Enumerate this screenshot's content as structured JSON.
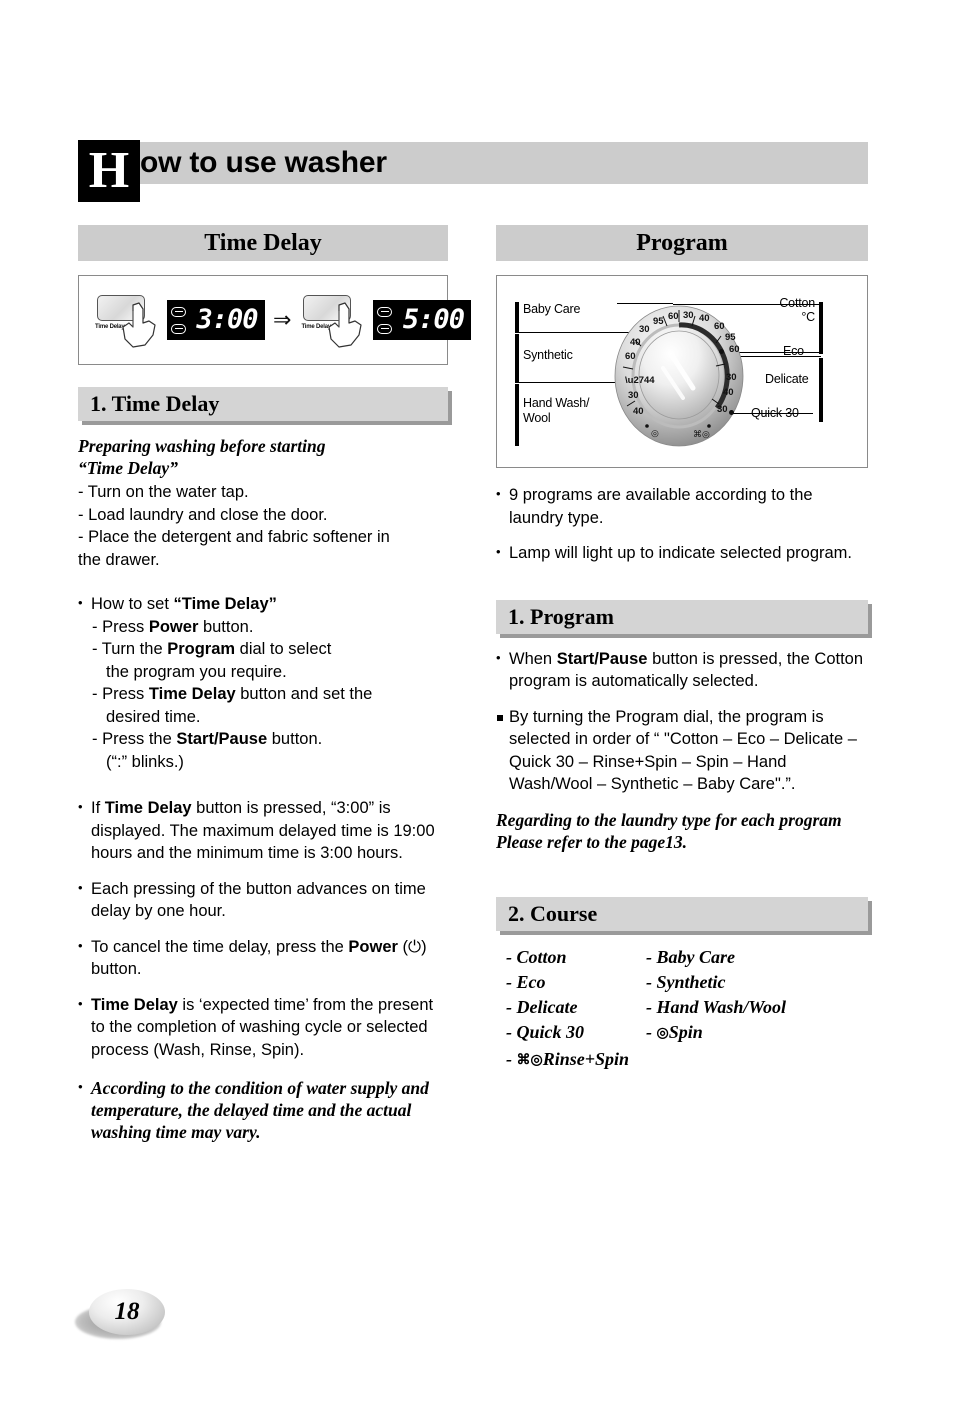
{
  "page": {
    "dropcap": "H",
    "header_title": "ow to use washer",
    "page_number": "18"
  },
  "left_column": {
    "title_bar": "Time Delay",
    "illustration": {
      "button_label_1": "Time Delay",
      "display_1": "3:00",
      "arrow": "⇒",
      "button_label_2": "Time Delay",
      "display_2": "5:00"
    },
    "sub_bar": "1. Time Delay",
    "intro_italic_line1": "Preparing washing before starting",
    "intro_italic_line2": "“Time Delay”",
    "prep_steps": [
      "- Turn on the water tap.",
      "- Load laundry and close the door.",
      "- Place the detergent and fabric softener in",
      "  the drawer."
    ],
    "howto_heading_plain": "How to set ",
    "howto_heading_bold": "“Time Delay”",
    "howto_steps": [
      {
        "pre": "- Press ",
        "bold": "Power",
        "post": " button."
      },
      {
        "pre": "- Turn the ",
        "bold": "Program",
        "post": " dial to select"
      },
      {
        "pre": "",
        "bold": "",
        "post": "the program you require."
      },
      {
        "pre": "- Press ",
        "bold": "Time Delay",
        "post": " button and set the"
      },
      {
        "pre": "",
        "bold": "",
        "post": "desired time."
      },
      {
        "pre": "- Press the ",
        "bold": "Start/Pause",
        "post": " button."
      },
      {
        "pre": "",
        "bold": "",
        "post": "(“:” blinks.)"
      }
    ],
    "para_if_pre": "If ",
    "para_if_bold": "Time Delay",
    "para_if_post": " button is pressed, “3:00” is displayed. The maximum delayed time is 19:00 hours and the minimum time is 3:00 hours.",
    "para_each": "Each pressing of the button advances on time delay by one hour.",
    "para_cancel_pre": "To cancel the time delay, press the ",
    "para_cancel_bold": "Power",
    "para_cancel_post": " (⏻) button.",
    "para_expected_bold": "Time Delay",
    "para_expected_post": " is ‘expected time’ from the present to the completion of washing cycle or selected process (Wash,  Rinse, Spin).",
    "para_note_italic": "According to the condition of water supply and temperature, the delayed time and the actual washing time may vary."
  },
  "right_column": {
    "title_bar": "Program",
    "dial": {
      "left_labels": [
        "Baby Care",
        "Synthetic",
        "Hand Wash/\nWool"
      ],
      "right_labels": [
        "Cotton\n°C",
        "Eco",
        "Delicate",
        "Quick 30"
      ],
      "ring_numbers_left": [
        "30",
        "95",
        "60",
        "40",
        "60",
        "30",
        "40"
      ],
      "ring_numbers_top": [
        "30",
        "40",
        "60"
      ],
      "ring_numbers_right": [
        "95",
        "60",
        "30",
        "40",
        "30"
      ]
    },
    "bullets_under_dial": [
      "9 programs are available according to the laundry type.",
      "Lamp will light up to indicate selected program."
    ],
    "sub_bar_program": "1. Program",
    "program_b1_pre": "When ",
    "program_b1_bold": "Start/Pause",
    "program_b1_post": " button is pressed, the Cotton program is automatically selected.",
    "program_b2": "By turning the Program dial, the program is selected in order of  “ \"Cotton – Eco – Delicate – Quick 30 – Rinse+Spin – Spin – Hand Wash/Wool – Synthetic – Baby Care\".”.",
    "program_note_line1": "Regarding to the laundry type for each program",
    "program_note_line2": "Please refer to the page13.",
    "sub_bar_course": "2. Course",
    "courses": [
      {
        "left": "- Cotton",
        "right": "- Baby Care",
        "left_sym": "",
        "right_sym": ""
      },
      {
        "left": "- Eco",
        "right": "- Synthetic",
        "left_sym": "",
        "right_sym": ""
      },
      {
        "left": "- Delicate",
        "right": "- Hand Wash/Wool",
        "left_sym": "",
        "right_sym": ""
      },
      {
        "left": "- Quick 30",
        "right": "- Spin",
        "left_sym": "",
        "right_sym": "◎"
      },
      {
        "left": "- Rinse+Spin",
        "right": "",
        "left_sym": "⌘◎",
        "right_sym": ""
      }
    ]
  }
}
